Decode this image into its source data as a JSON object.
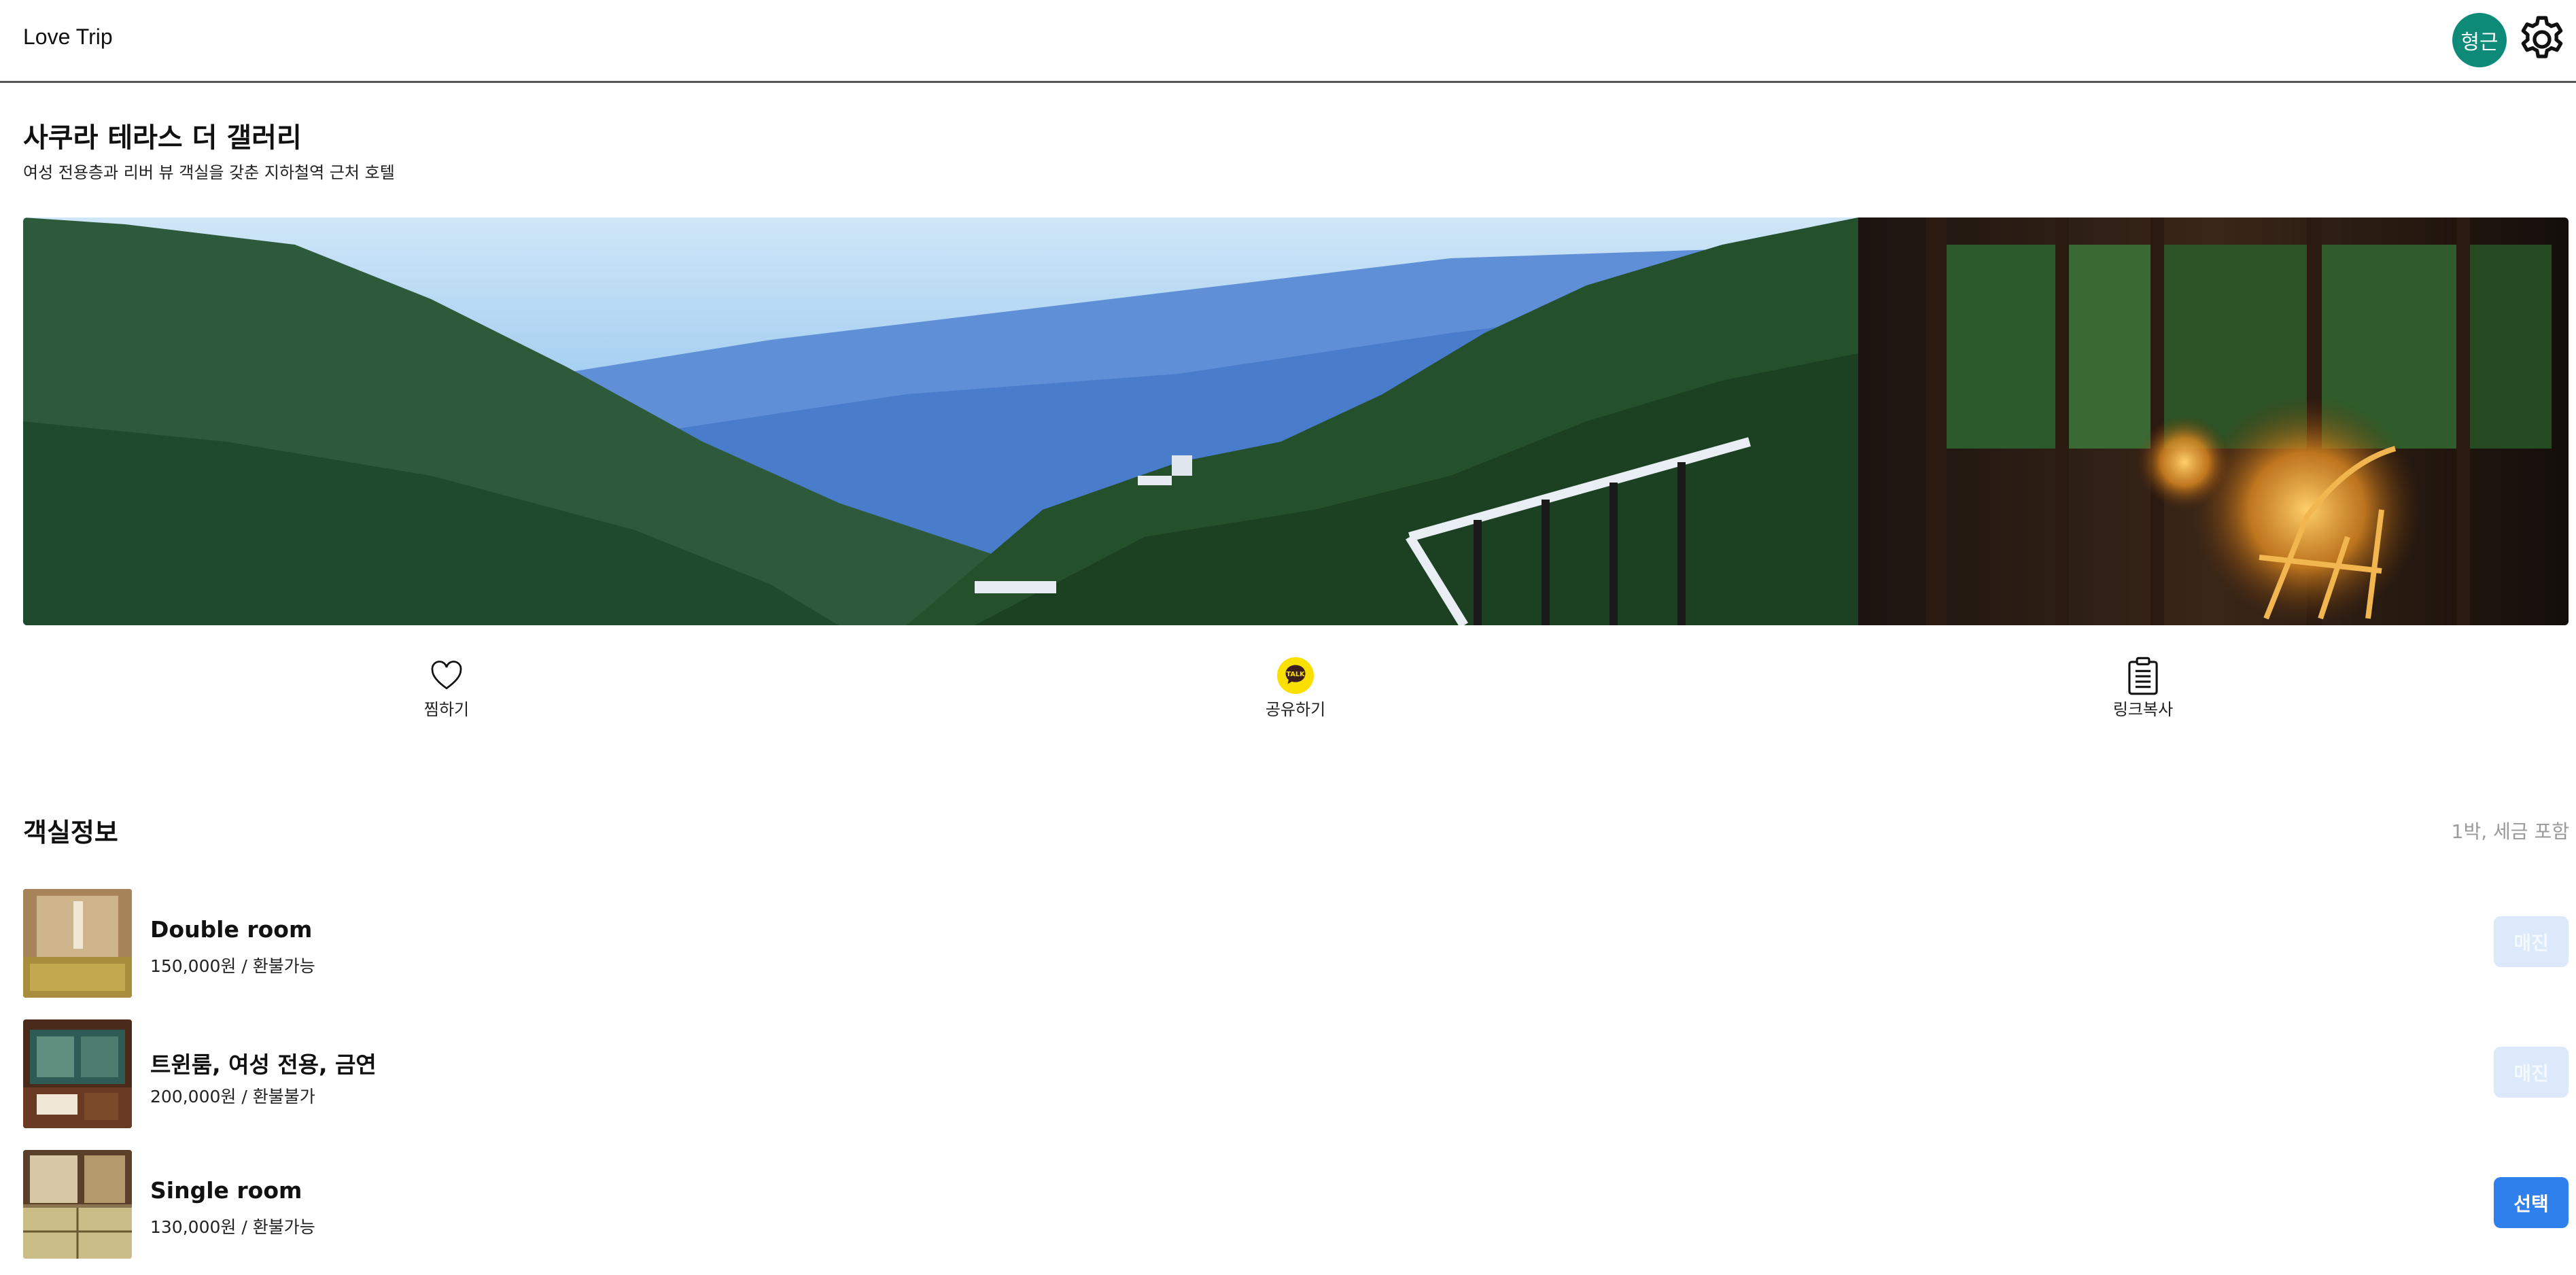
{
  "header": {
    "brand": "Love Trip",
    "user_initials": "형근",
    "settings_icon": "gear-icon"
  },
  "hotel": {
    "name": "사쿠라 테라스 더 갤러리",
    "description": "여성 전용층과 리버 뷰 객실을 갖춘 지하철역 근처 호텔"
  },
  "actions": [
    {
      "label": "찜하기",
      "icon": "heart-icon"
    },
    {
      "label": "공유하기",
      "icon": "kakaotalk-icon",
      "badge_text": "TALK"
    },
    {
      "label": "링크복사",
      "icon": "clipboard-icon"
    }
  ],
  "rooms_section": {
    "title": "객실정보",
    "note": "1박, 세금 포함"
  },
  "rooms": [
    {
      "name": "Double room",
      "price": "150,000원 / 환불가능",
      "button": "매진",
      "status": "soldout"
    },
    {
      "name": "트윈룸, 여성 전용, 금연",
      "price": "200,000원 / 환불불가",
      "button": "매진",
      "status": "soldout"
    },
    {
      "name": "Single room",
      "price": "130,000원 / 환불가능",
      "button": "선택",
      "status": "available"
    }
  ],
  "colors": {
    "avatar": "#0e8a78",
    "primary": "#2f80ed",
    "soldout": "#dbe9fb",
    "kakao": "#f9e000"
  }
}
